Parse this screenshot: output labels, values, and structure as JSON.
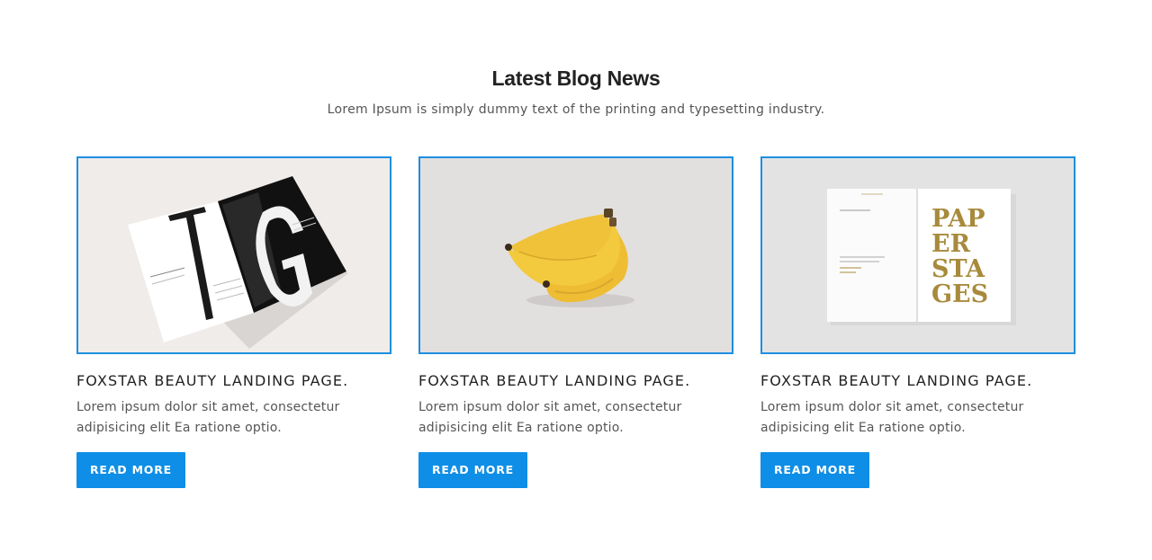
{
  "section": {
    "title": "Latest Blog News",
    "subtitle": "Lorem Ipsum is simply dummy text of the printing and typesetting industry."
  },
  "posts": [
    {
      "image": "magazine-spread-image",
      "title": "FOXSTAR BEAUTY LANDING PAGE.",
      "excerpt": "Lorem ipsum dolor sit amet, consectetur adipisicing elit Ea ratione optio.",
      "button": "READ MORE"
    },
    {
      "image": "bananas-image",
      "title": "FOXSTAR BEAUTY LANDING PAGE.",
      "excerpt": "Lorem ipsum dolor sit amet, consectetur adipisicing elit Ea ratione optio.",
      "button": "READ MORE"
    },
    {
      "image": "paper-stages-booklet-image",
      "title": "FOXSTAR BEAUTY LANDING PAGE.",
      "excerpt": "Lorem ipsum dolor sit amet, consectetur adipisicing elit Ea ratione optio.",
      "button": "READ MORE"
    }
  ],
  "image_text": {
    "booklet_word": [
      "PAP",
      "ER",
      "STA",
      "GES"
    ]
  },
  "colors": {
    "accent": "#0e8ee6",
    "thumb_border": "#1e8fe0",
    "gold": "#a88a3c"
  }
}
